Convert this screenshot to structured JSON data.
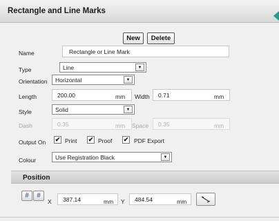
{
  "panel": {
    "title": "Rectangle and Line Marks"
  },
  "actions": {
    "new_label": "New",
    "delete_label": "Delete"
  },
  "form": {
    "name_label": "Name",
    "name_value": "Rectangle or Line Mark",
    "type_label": "Type",
    "type_value": "Line",
    "orientation_label": "Orientation",
    "orientation_value": "Horizontal",
    "length_label": "Length",
    "length_value": "200.00",
    "length_unit": "mm",
    "width_label": "Width",
    "width_value": "0.71",
    "width_unit": "mm",
    "style_label": "Style",
    "style_value": "Solid",
    "dash_label": "Dash",
    "dash_value": "0.35",
    "dash_unit": "mm",
    "space_label": "Space",
    "space_value": "0.35",
    "space_unit": "mm",
    "output_label": "Output On",
    "output_options": [
      {
        "label": "Print",
        "checked": true
      },
      {
        "label": "Proof",
        "checked": true
      },
      {
        "label": "PDF Export",
        "checked": true
      }
    ],
    "colour_label": "Colour",
    "colour_value": "Use Registration Black"
  },
  "position": {
    "title": "Position",
    "x_label": "X",
    "x_value": "387.14",
    "x_unit": "mm",
    "y_label": "Y",
    "y_value": "484.54",
    "y_unit": "mm"
  },
  "icons": {
    "check": "✔",
    "arrow": "▼"
  },
  "colors": {
    "accent_tab": "#1f9e8c"
  }
}
